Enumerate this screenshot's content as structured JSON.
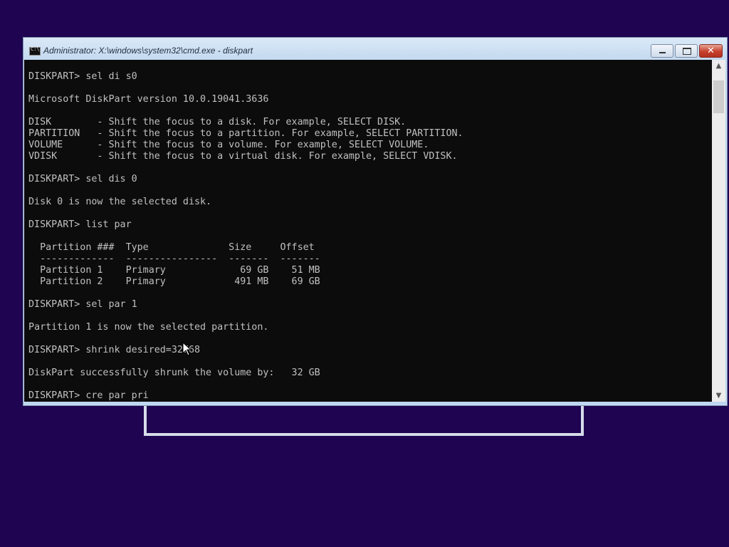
{
  "window": {
    "title": "Administrator: X:\\windows\\system32\\cmd.exe - diskpart",
    "controls": {
      "minimize": "minimize",
      "maximize": "maximize",
      "close": "✕"
    }
  },
  "console": {
    "lines": [
      "DISKPART> sel di s0",
      "",
      "Microsoft DiskPart version 10.0.19041.3636",
      "",
      "DISK        - Shift the focus to a disk. For example, SELECT DISK.",
      "PARTITION   - Shift the focus to a partition. For example, SELECT PARTITION.",
      "VOLUME      - Shift the focus to a volume. For example, SELECT VOLUME.",
      "VDISK       - Shift the focus to a virtual disk. For example, SELECT VDISK.",
      "",
      "DISKPART> sel dis 0",
      "",
      "Disk 0 is now the selected disk.",
      "",
      "DISKPART> list par",
      "",
      "  Partition ###  Type              Size     Offset",
      "  -------------  ----------------  -------  -------",
      "  Partition 1    Primary             69 GB    51 MB",
      "  Partition 2    Primary            491 MB    69 GB",
      "",
      "DISKPART> sel par 1",
      "",
      "Partition 1 is now the selected partition.",
      "",
      "DISKPART> shrink desired=32768",
      "",
      "DiskPart successfully shrunk the volume by:   32 GB",
      "",
      "DISKPART> cre par pri"
    ]
  },
  "scrollbar": {
    "up_arrow": "▲",
    "down_arrow": "▼"
  }
}
